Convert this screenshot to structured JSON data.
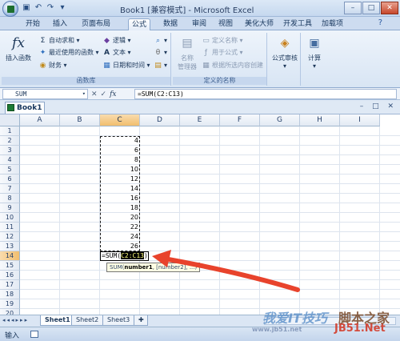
{
  "app": {
    "title": "Book1  [兼容模式]  - Microsoft Excel",
    "window_controls": {
      "minimize": "–",
      "maximize": "□",
      "close": "✕"
    }
  },
  "ribbon_tabs": [
    "开始",
    "插入",
    "页面布局",
    "公式",
    "数据",
    "审阅",
    "视图",
    "美化大师",
    "开发工具",
    "加载项"
  ],
  "active_tab": "公式",
  "function_library": {
    "insert_function": "插入函数",
    "autosum": "自动求和",
    "recent": "最近使用的函数",
    "financial": "财务",
    "logical": "逻辑",
    "text": "文本",
    "datetime": "日期和时间",
    "group_label": "函数库"
  },
  "defined_names": {
    "name_manager_1": "名称",
    "name_manager_2": "管理器",
    "define_name": "定义名称",
    "use_in_formula": "用于公式",
    "create_from_selection": "根据所选内容创建",
    "group_label": "定义的名称"
  },
  "formula_audit": {
    "label": "公式审核"
  },
  "calculation": {
    "label": "计算"
  },
  "formula_bar": {
    "name_box": "SUM",
    "cancel_icon": "✕",
    "enter_icon": "✓",
    "fx_label": "fx",
    "formula": "=SUM(C2:C13)"
  },
  "workbook_tab": "Book1 *",
  "columns": [
    "A",
    "B",
    "C",
    "D",
    "E",
    "F",
    "G",
    "H",
    "I"
  ],
  "selected_column": "C",
  "rows": [
    "1",
    "2",
    "3",
    "4",
    "5",
    "6",
    "7",
    "8",
    "9",
    "10",
    "11",
    "12",
    "13",
    "14",
    "15",
    "16",
    "17",
    "18",
    "19",
    "20"
  ],
  "selected_row": "14",
  "cells_c": [
    "4",
    "6",
    "8",
    "10",
    "12",
    "14",
    "16",
    "18",
    "20",
    "22",
    "24",
    "26"
  ],
  "edit_cell": {
    "prefix": "=SUM(",
    "ref": "C2:C13",
    "suffix": ")"
  },
  "tooltip": {
    "func": "SUM(",
    "arg1": "number1",
    "rest": ", [number2], ...)"
  },
  "sheets": [
    "Sheet1",
    "Sheet2",
    "Sheet3"
  ],
  "active_sheet": "Sheet1",
  "status": {
    "mode": "输入"
  },
  "watermark": {
    "main": "我爱IT技巧",
    "site": "脚本之家",
    "url": "www.jb51.net",
    "jb": "JB51.Net"
  },
  "colors": {
    "accent": "#17365d",
    "arrow": "#e8432c",
    "selected_header": "#f1be6e"
  }
}
